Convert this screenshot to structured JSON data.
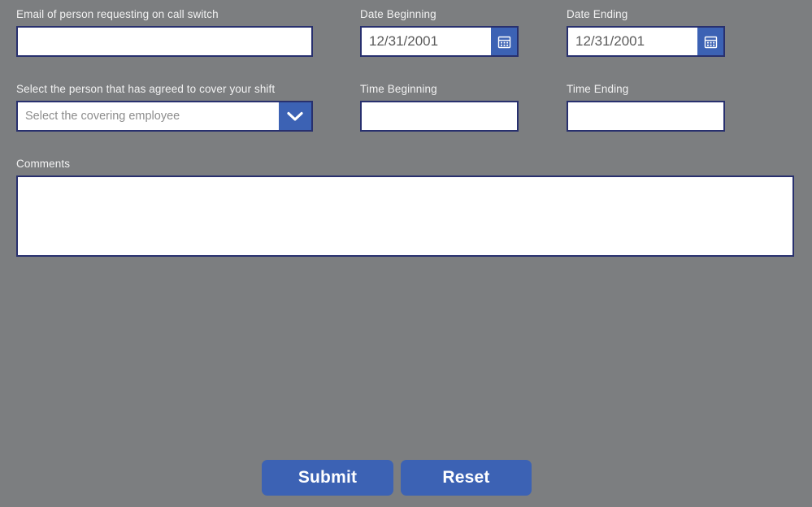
{
  "form": {
    "fields": {
      "requester_email": {
        "label": "Email of person requesting on call switch",
        "value": "",
        "placeholder": ""
      },
      "date_beginning": {
        "label": "Date Beginning",
        "value": "12/31/2001",
        "icon": "calendar-icon"
      },
      "date_ending": {
        "label": "Date Ending",
        "value": "12/31/2001",
        "icon": "calendar-icon"
      },
      "covering_employee": {
        "label": "Select the person that has agreed to cover your shift",
        "value": "",
        "placeholder": "Select the covering employee",
        "icon": "chevron-down-icon"
      },
      "time_beginning": {
        "label": "Time Beginning",
        "value": "",
        "placeholder": ""
      },
      "time_ending": {
        "label": "Time Ending",
        "value": "",
        "placeholder": ""
      },
      "comments": {
        "label": "Comments",
        "value": "",
        "placeholder": ""
      }
    },
    "actions": {
      "submit_label": "Submit",
      "reset_label": "Reset"
    },
    "colors": {
      "background": "#7c7e80",
      "accent_blue": "#3c62b4",
      "border_navy": "#28306e",
      "label_text": "#f2f2f2",
      "field_background": "#ffffff",
      "placeholder_text": "#8d8d8d"
    }
  }
}
